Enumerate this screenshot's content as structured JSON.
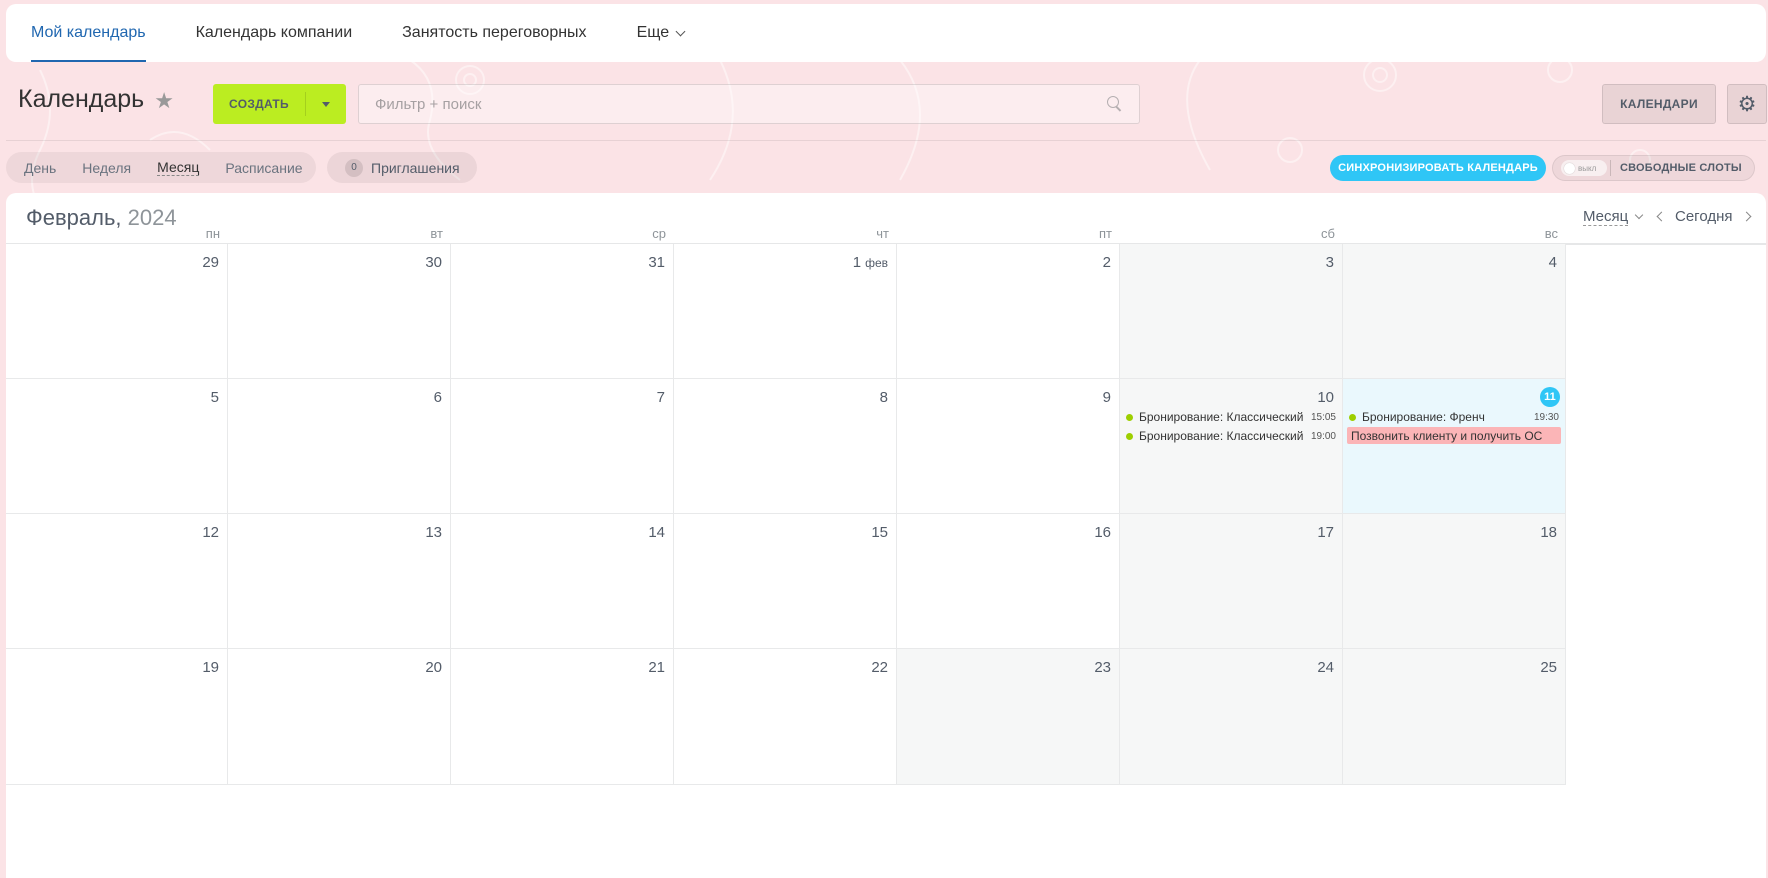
{
  "topnav": {
    "tabs": [
      {
        "label": "Мой календарь",
        "active": true
      },
      {
        "label": "Календарь компании",
        "active": false
      },
      {
        "label": "Занятость переговорных",
        "active": false
      },
      {
        "label": "Еще",
        "active": false
      }
    ]
  },
  "header": {
    "title": "Календарь",
    "create_label": "СОЗДАТЬ",
    "search_placeholder": "Фильтр + поиск",
    "calendars_label": "КАЛЕНДАРИ"
  },
  "views": {
    "items": [
      "День",
      "Неделя",
      "Месяц",
      "Расписание"
    ],
    "active": "Месяц",
    "invites_count": "0",
    "invites_label": "Приглашения",
    "sync_label": "СИНХРОНИЗИРОВАТЬ КАЛЕНДАРЬ",
    "toggle_state": "выкл",
    "free_slots_label": "СВОБОДНЫЕ СЛОТЫ"
  },
  "calendar": {
    "month": "Февраль,",
    "year": "2024",
    "view_select": "Месяц",
    "today_label": "Сегодня",
    "weekdays": [
      "пн",
      "вт",
      "ср",
      "чт",
      "пт",
      "сб",
      "вс"
    ],
    "weeks": [
      [
        {
          "d": "29"
        },
        {
          "d": "30"
        },
        {
          "d": "31"
        },
        {
          "d": "1",
          "mon": "фев"
        },
        {
          "d": "2"
        },
        {
          "d": "3",
          "weekend": true
        },
        {
          "d": "4",
          "weekend": true
        }
      ],
      [
        {
          "d": "5"
        },
        {
          "d": "6"
        },
        {
          "d": "7"
        },
        {
          "d": "8"
        },
        {
          "d": "9"
        },
        {
          "d": "10",
          "weekend": true
        },
        {
          "d": "11",
          "today": true
        }
      ],
      [
        {
          "d": "12"
        },
        {
          "d": "13"
        },
        {
          "d": "14"
        },
        {
          "d": "15"
        },
        {
          "d": "16"
        },
        {
          "d": "17",
          "weekend": true
        },
        {
          "d": "18",
          "weekend": true
        }
      ],
      [
        {
          "d": "19"
        },
        {
          "d": "20"
        },
        {
          "d": "21"
        },
        {
          "d": "22"
        },
        {
          "d": "23",
          "weekend": true
        },
        {
          "d": "24",
          "weekend": true
        },
        {
          "d": "25",
          "weekend": true
        }
      ]
    ],
    "events": [
      {
        "week": 1,
        "day": 5,
        "type": "dot",
        "name": "Бронирование: Классический",
        "time": "15:05",
        "color": "#9dcf00"
      },
      {
        "week": 1,
        "day": 5,
        "type": "dot",
        "name": "Бронирование: Классический",
        "time": "19:00",
        "color": "#9dcf00"
      },
      {
        "week": 1,
        "day": 6,
        "type": "dot",
        "name": "Бронирование: Френч",
        "time": "19:30",
        "color": "#9dcf00"
      },
      {
        "week": 1,
        "day": 6,
        "type": "bar",
        "name": "Позвонить клиенту и получить ОС",
        "color": "#fbb5b7"
      }
    ]
  },
  "colors": {
    "accent": "#2067b0",
    "create": "#bbed21",
    "sync": "#2fc6f6",
    "background": "#fbe3e6"
  }
}
